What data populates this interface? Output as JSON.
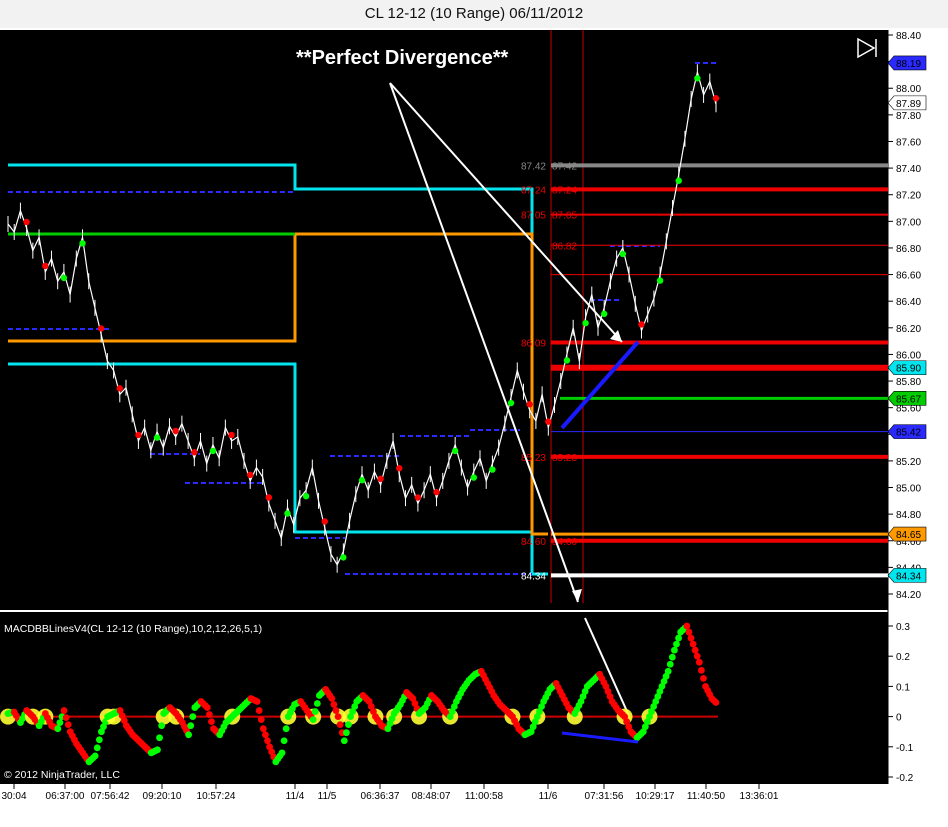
{
  "title": "CL 12-12 (10 Range)  06/11/2012",
  "annotation": "**Perfect Divergence**",
  "indicator_label": "MACDBBLinesV4(CL 12-12 (10 Range),10,2,12,26,5,1)",
  "copyright": "© 2012 NinjaTrader, LLC",
  "colors": {
    "background": "#000000",
    "up_bar": "#00ff00",
    "down_bar": "#ff0000",
    "cyan": "#00e5ee",
    "orange": "#ff9900",
    "green_level": "#00cc00",
    "red_level": "#ee0000",
    "blue_dashed": "#2a2aff",
    "divergence_line": "#1a1aff",
    "gray_level": "#888888"
  },
  "chart_data": {
    "type": "line",
    "price_axis": {
      "ylim": [
        84.1,
        88.45
      ],
      "ticks": [
        84.2,
        84.4,
        84.6,
        84.8,
        85.0,
        85.2,
        85.4,
        85.6,
        85.8,
        86.0,
        86.2,
        86.4,
        86.6,
        86.8,
        87.0,
        87.2,
        87.4,
        87.6,
        87.8,
        88.0,
        88.2,
        88.4
      ],
      "tick_labels": [
        "84.20",
        "84.40",
        "84.60",
        "84.80",
        "85.00",
        "85.20",
        "85.40",
        "85.60",
        "85.80",
        "86.00",
        "86.20",
        "86.40",
        "86.60",
        "86.80",
        "87.00",
        "87.20",
        "87.40",
        "87.60",
        "87.80",
        "88.00",
        "88.20",
        "88.40"
      ]
    },
    "indicator_axis": {
      "ylim": [
        -0.21,
        0.32
      ],
      "ticks": [
        -0.2,
        -0.1,
        0,
        0.1,
        0.2,
        0.3
      ],
      "tick_labels": [
        "-0.2",
        "-0.1",
        "0",
        "0.1",
        "0.2",
        "0.3"
      ]
    },
    "x_tick_labels": [
      "30:04",
      "06:37:00",
      "07:56:42",
      "09:20:10",
      "10:57:24",
      "11/4",
      "11/5",
      "06:36:37",
      "08:48:07",
      "11:00:58",
      "11/6",
      "07:31:56",
      "10:29:17",
      "11:40:50",
      "13:36:01"
    ],
    "price_markers": [
      {
        "label": "88.19",
        "value": 88.19,
        "bg": "#2a2aff",
        "fg": "#ffffff"
      },
      {
        "label": "87.89",
        "value": 87.89,
        "bg": "#ffffff",
        "fg": "#000000"
      },
      {
        "label": "85.90",
        "value": 85.9,
        "bg": "#00e5ee",
        "fg": "#000000"
      },
      {
        "label": "85.67",
        "value": 85.67,
        "bg": "#00cc00",
        "fg": "#000000"
      },
      {
        "label": "85.42",
        "value": 85.42,
        "bg": "#2a2aff",
        "fg": "#ffffff"
      },
      {
        "label": "84.65",
        "value": 84.65,
        "bg": "#ff9900",
        "fg": "#000000"
      },
      {
        "label": "84.34",
        "value": 84.34,
        "bg": "#00e5ee",
        "fg": "#000000"
      }
    ],
    "level_labels_left": [
      {
        "label": "87.42",
        "value": 87.42,
        "color": "#888888"
      },
      {
        "label": "87.24",
        "value": 87.24,
        "color": "#ee0000"
      },
      {
        "label": "87.05",
        "value": 87.05,
        "color": "#ee0000"
      },
      {
        "label": "86.09",
        "value": 86.09,
        "color": "#ee0000"
      },
      {
        "label": "85.23",
        "value": 85.23,
        "color": "#ee0000"
      },
      {
        "label": "84.60",
        "value": 84.6,
        "color": "#ee0000"
      },
      {
        "label": "84.34",
        "value": 84.34,
        "color": "#ffffff"
      }
    ],
    "level_labels_right": [
      {
        "label": "87.42",
        "value": 87.42,
        "color": "#888888"
      },
      {
        "label": "87.24",
        "value": 87.24,
        "color": "#ee0000"
      },
      {
        "label": "87.05",
        "value": 87.05,
        "color": "#ee0000"
      },
      {
        "label": "86.82",
        "value": 86.82,
        "color": "#ee0000"
      },
      {
        "label": "85.23",
        "value": 85.23,
        "color": "#ee0000"
      },
      {
        "label": "84.60",
        "value": 84.6,
        "color": "#ee0000"
      }
    ],
    "horizontal_levels": [
      {
        "value": 87.42,
        "color": "#888888",
        "width": 4
      },
      {
        "value": 87.24,
        "color": "#ee0000",
        "width": 4
      },
      {
        "value": 87.05,
        "color": "#ee0000",
        "width": 2
      },
      {
        "value": 86.82,
        "color": "#ee0000",
        "width": 1
      },
      {
        "value": 86.6,
        "color": "#ee0000",
        "width": 1
      },
      {
        "value": 86.09,
        "color": "#ee0000",
        "width": 4
      },
      {
        "value": 85.9,
        "color": "#ee0000",
        "width": 6
      },
      {
        "value": 85.67,
        "color": "#00cc00",
        "width": 3
      },
      {
        "value": 85.42,
        "color": "#2a2aff",
        "width": 1
      },
      {
        "value": 85.23,
        "color": "#ee0000",
        "width": 4
      },
      {
        "value": 84.65,
        "color": "#ff9900",
        "width": 3
      },
      {
        "value": 84.6,
        "color": "#ee0000",
        "width": 4
      },
      {
        "value": 84.34,
        "color": "#ffffff",
        "width": 4
      }
    ],
    "price_series": [
      86.98,
      86.92,
      87.08,
      86.95,
      86.78,
      86.88,
      86.62,
      86.72,
      86.55,
      86.62,
      86.45,
      86.72,
      86.88,
      86.55,
      86.35,
      86.15,
      85.95,
      85.88,
      85.7,
      85.75,
      85.55,
      85.35,
      85.45,
      85.28,
      85.42,
      85.3,
      85.46,
      85.38,
      85.48,
      85.35,
      85.22,
      85.35,
      85.18,
      85.32,
      85.22,
      85.45,
      85.35,
      85.38,
      85.2,
      85.05,
      85.15,
      85.08,
      84.88,
      84.75,
      84.62,
      84.85,
      84.72,
      84.92,
      84.98,
      85.15,
      84.9,
      84.7,
      84.5,
      84.42,
      84.52,
      84.75,
      84.95,
      85.1,
      84.98,
      85.12,
      85.02,
      85.2,
      85.35,
      85.1,
      84.92,
      85.02,
      84.88,
      84.98,
      85.1,
      84.92,
      85.05,
      85.2,
      85.32,
      85.15,
      85.0,
      85.12,
      85.22,
      85.05,
      85.18,
      85.3,
      85.48,
      85.68,
      85.88,
      85.72,
      85.58,
      85.5,
      85.7,
      85.45,
      85.62,
      85.8,
      86.0,
      86.2,
      85.95,
      86.28,
      86.45,
      86.2,
      86.35,
      86.55,
      86.72,
      86.8,
      86.6,
      86.38,
      86.18,
      86.3,
      86.42,
      86.6,
      86.85,
      87.1,
      87.35,
      87.62,
      87.92,
      88.12,
      87.95,
      88.05,
      87.88
    ],
    "indicator_series": [
      0.01,
      0.015,
      -0.02,
      0.02,
      0.0,
      -0.03,
      0.01,
      -0.03,
      -0.04,
      0.02,
      -0.05,
      -0.09,
      -0.12,
      -0.15,
      -0.13,
      -0.05,
      0.0,
      0.01,
      0.02,
      -0.03,
      -0.06,
      -0.08,
      -0.1,
      -0.12,
      -0.11,
      0.01,
      0.03,
      0.01,
      -0.02,
      -0.06,
      0.03,
      0.05,
      0.03,
      -0.04,
      -0.06,
      -0.02,
      0.0,
      0.02,
      0.04,
      0.06,
      0.05,
      -0.04,
      -0.1,
      -0.15,
      -0.12,
      0.0,
      0.04,
      0.05,
      0.02,
      -0.01,
      0.07,
      0.09,
      0.06,
      0.0,
      -0.08,
      0.0,
      0.05,
      0.07,
      0.05,
      0.0,
      -0.03,
      -0.04,
      0.01,
      0.04,
      0.08,
      0.06,
      0.01,
      0.03,
      0.07,
      0.05,
      0.02,
      0.0,
      0.05,
      0.09,
      0.12,
      0.14,
      0.15,
      0.11,
      0.07,
      0.04,
      0.02,
      0.0,
      -0.04,
      -0.06,
      -0.05,
      0.0,
      0.05,
      0.09,
      0.11,
      0.07,
      0.03,
      0.01,
      0.05,
      0.1,
      0.12,
      0.14,
      0.1,
      0.05,
      0.02,
      0.0,
      -0.05,
      -0.07,
      -0.05,
      0.0,
      0.05,
      0.1,
      0.15,
      0.22,
      0.28,
      0.3,
      0.24,
      0.18,
      0.1,
      0.06,
      0.04
    ]
  }
}
